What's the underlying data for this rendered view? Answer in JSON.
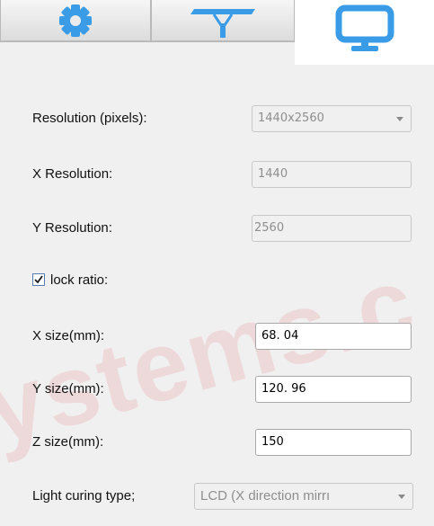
{
  "tabs": [
    {
      "icon": "gear-icon",
      "selected": false
    },
    {
      "icon": "support-tree-icon",
      "selected": false
    },
    {
      "icon": "monitor-icon",
      "selected": true
    }
  ],
  "colors": {
    "accent": "#3a9be6",
    "watermark": "#e62832"
  },
  "watermark_text": "ystems.c",
  "form": {
    "resolution": {
      "label": "Resolution (pixels):",
      "value": "1440x2560"
    },
    "x_resolution": {
      "label": "X Resolution:",
      "value": "1440"
    },
    "y_resolution": {
      "label": "Y Resolution:",
      "value": "2560"
    },
    "lock_ratio": {
      "label": "lock ratio:",
      "checked": true
    },
    "x_size": {
      "label": "X size(mm):",
      "value": "68. 04"
    },
    "y_size": {
      "label": "Y size(mm):",
      "value": "120. 96"
    },
    "z_size": {
      "label": "Z size(mm):",
      "value": "150"
    },
    "light_curing": {
      "label": "Light curing type;",
      "value": "LCD (X direction mirrı"
    }
  }
}
